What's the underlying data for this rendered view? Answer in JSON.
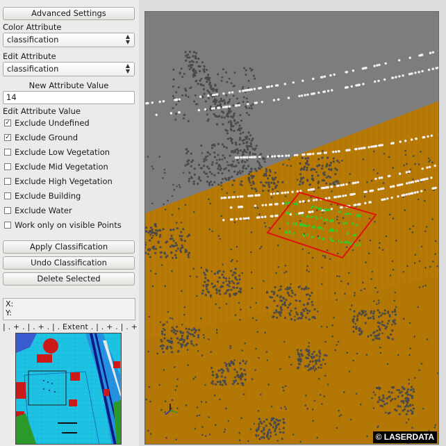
{
  "panel": {
    "advanced_settings_button": "Advanced Settings",
    "color_attribute_label": "Color Attribute",
    "color_attribute_value": "classification",
    "edit_attribute_label": "Edit Attribute",
    "edit_attribute_value": "classification",
    "new_value_label": "New Attribute Value",
    "new_value": "14",
    "edit_value_label": "Edit Attribute Value",
    "checkboxes": [
      {
        "label": "Exclude Undefined",
        "checked": true
      },
      {
        "label": "Exclude Ground",
        "checked": true
      },
      {
        "label": "Exclude Low Vegetation",
        "checked": false
      },
      {
        "label": "Exclude Mid Vegetation",
        "checked": false
      },
      {
        "label": "Exclude High Vegetation",
        "checked": false
      },
      {
        "label": "Exclude Building",
        "checked": false
      },
      {
        "label": "Exclude Water",
        "checked": false
      },
      {
        "label": "Work only on visible Points",
        "checked": false
      }
    ],
    "apply_button": "Apply Classification",
    "undo_button": "Undo Classification",
    "delete_button": "Delete Selected",
    "x_label": "X:",
    "y_label": "Y:",
    "extent_ruler": "| . + . | . + . | .  Extent  . | . + . | . + . |"
  },
  "viewer": {
    "watermark": "© LASERDATA"
  },
  "colors": {
    "ground": "#b87a06",
    "sky": "#7d7d7d",
    "points_gray": "#4a4a4a",
    "wire_white": "#f2f2f2",
    "selection": "#e01010",
    "selected_points": "#2ccf2c",
    "minimap_water": "#20c8e8"
  }
}
